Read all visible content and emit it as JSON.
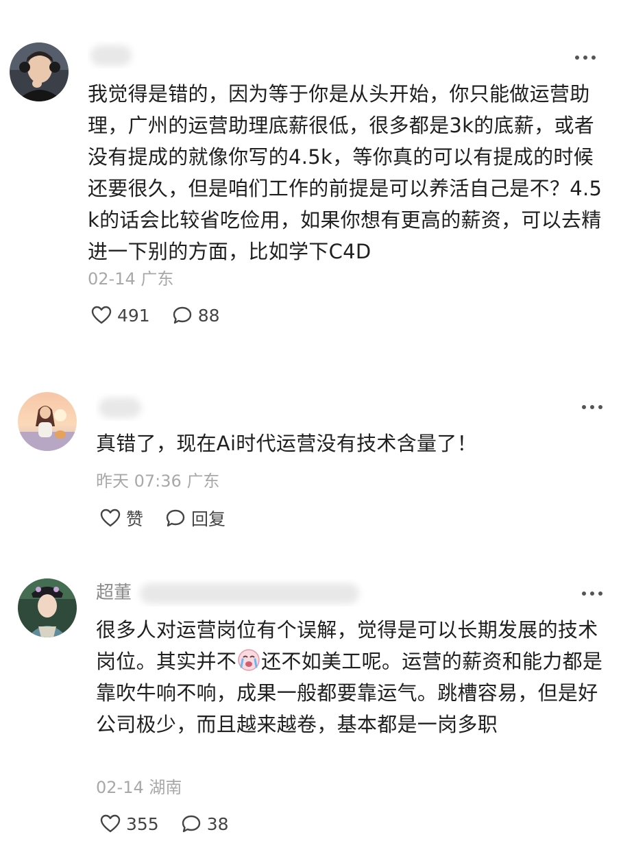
{
  "comments": [
    {
      "username_visible": "",
      "text": "我觉得是错的，因为等于你是从头开始，你只能做运营助理，广州的运营助理底薪很低，很多都是3k的底薪，或者没有提成的就像你写的4.5k，等你真的可以有提成的时候还要很久，但是咱们工作的前提是可以养活自己是不？4.5k的话会比较省吃俭用，如果你想有更高的薪资，可以去精进一下别的方面，比如学下C4D",
      "date": "02-14",
      "location": "广东",
      "likes": "491",
      "replies": "88",
      "like_icon": "heart-icon",
      "reply_icon": "comment-bubble-icon",
      "more_icon": "more-dots-icon"
    },
    {
      "username_visible": "",
      "text": "真错了，现在Ai时代运营没有技术含量了！",
      "date": "昨天 07:36",
      "location": "广东",
      "likes": "赞",
      "replies": "回复",
      "like_icon": "heart-icon",
      "reply_icon": "comment-bubble-icon",
      "more_icon": "more-dots-icon"
    },
    {
      "username_visible": "超董",
      "text_part1": "很多人对运营岗位有个误解，觉得是可以长期发展的技术岗位。其实并不",
      "emoji": "crying-emoji",
      "text_part2": "还不如美工呢。运营的薪资和能力都是靠吹牛响不响，成果一般都要靠运气。跳槽容易，但是好公司极少，而且越来越卷，基本都是一岗多职",
      "date": "02-14",
      "location": "湖南",
      "likes": "355",
      "replies": "38",
      "like_icon": "heart-icon",
      "reply_icon": "comment-bubble-icon",
      "more_icon": "more-dots-icon"
    }
  ],
  "colors": {
    "text": "#1f1f1f",
    "meta": "#a8a8a8",
    "icon": "#444444",
    "background": "#ffffff"
  }
}
